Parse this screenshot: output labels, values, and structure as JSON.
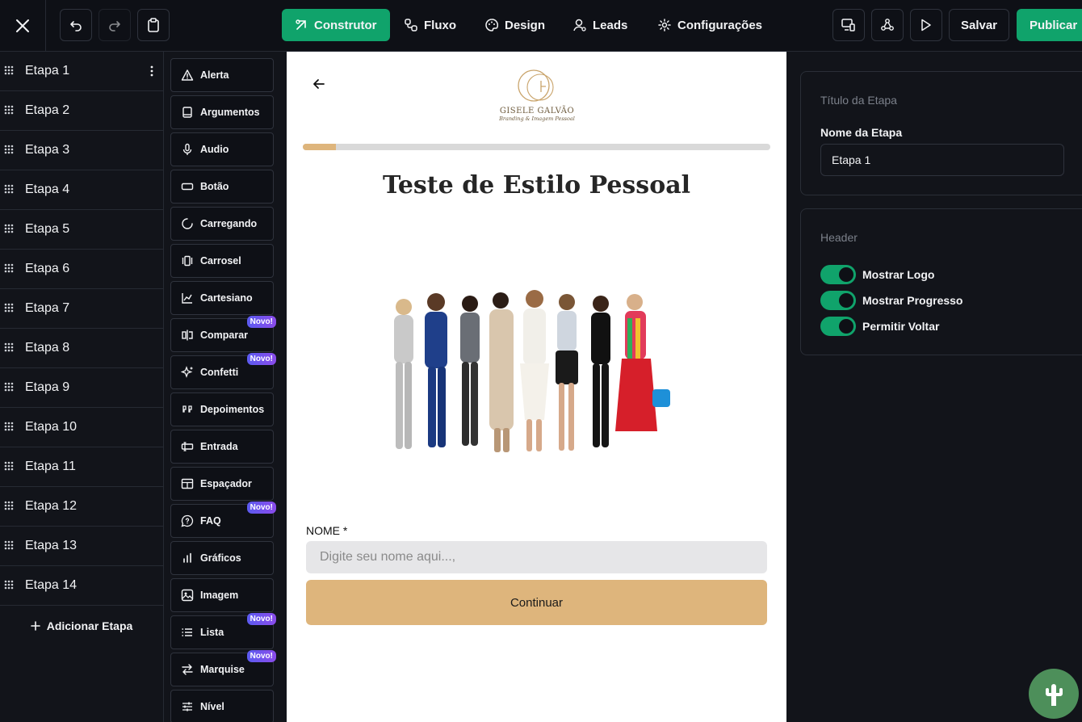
{
  "topbar": {
    "nav": [
      {
        "label": "Construtor",
        "icon": "construtor-icon",
        "active": true
      },
      {
        "label": "Fluxo",
        "icon": "flow-icon",
        "active": false
      },
      {
        "label": "Design",
        "icon": "palette-icon",
        "active": false
      },
      {
        "label": "Leads",
        "icon": "user-icon",
        "active": false
      },
      {
        "label": "Configurações",
        "icon": "gear-icon",
        "active": false
      }
    ],
    "save_label": "Salvar",
    "publish_label": "Publicar"
  },
  "steps": {
    "items": [
      "Etapa 1",
      "Etapa 2",
      "Etapa 3",
      "Etapa 4",
      "Etapa 5",
      "Etapa 6",
      "Etapa 7",
      "Etapa 8",
      "Etapa 9",
      "Etapa 10",
      "Etapa 11",
      "Etapa 12",
      "Etapa 13",
      "Etapa 14"
    ],
    "add_label": "Adicionar Etapa"
  },
  "components": {
    "badge_label": "Novo!",
    "items": [
      {
        "label": "Alerta",
        "icon": "alert-icon",
        "badge": false
      },
      {
        "label": "Argumentos",
        "icon": "book-icon",
        "badge": false
      },
      {
        "label": "Audio",
        "icon": "mic-icon",
        "badge": false
      },
      {
        "label": "Botão",
        "icon": "button-icon",
        "badge": false
      },
      {
        "label": "Carregando",
        "icon": "loading-icon",
        "badge": false
      },
      {
        "label": "Carrosel",
        "icon": "carousel-icon",
        "badge": false
      },
      {
        "label": "Cartesiano",
        "icon": "chart-area-icon",
        "badge": false
      },
      {
        "label": "Comparar",
        "icon": "compare-icon",
        "badge": true
      },
      {
        "label": "Confetti",
        "icon": "sparkles-icon",
        "badge": true
      },
      {
        "label": "Depoimentos",
        "icon": "quote-icon",
        "badge": false
      },
      {
        "label": "Entrada",
        "icon": "input-icon",
        "badge": false
      },
      {
        "label": "Espaçador",
        "icon": "spacer-icon",
        "badge": false
      },
      {
        "label": "FAQ",
        "icon": "faq-icon",
        "badge": true
      },
      {
        "label": "Gráficos",
        "icon": "bar-chart-icon",
        "badge": false
      },
      {
        "label": "Imagem",
        "icon": "image-icon",
        "badge": false
      },
      {
        "label": "Lista",
        "icon": "list-icon",
        "badge": true
      },
      {
        "label": "Marquise",
        "icon": "arrows-icon",
        "badge": true
      },
      {
        "label": "Nível",
        "icon": "sliders-icon",
        "badge": false
      }
    ]
  },
  "canvas": {
    "logo_brand": "GISELE GALVÃO",
    "logo_tagline": "Branding & Imagem Pessoal",
    "progress_fraction": 0.07,
    "title": "Teste de Estilo Pessoal",
    "field_label": "NOME *",
    "field_placeholder": "Digite seu nome aqui...,",
    "cta_label": "Continuar",
    "colors": {
      "accent": "#deb57c",
      "primary": "#10a36b"
    }
  },
  "panel": {
    "step_section_title": "Título da Etapa",
    "step_name_label": "Nome da Etapa",
    "step_name_value": "Etapa 1",
    "header_section_title": "Header",
    "toggles": [
      {
        "label": "Mostrar Logo",
        "on": true
      },
      {
        "label": "Mostrar Progresso",
        "on": true
      },
      {
        "label": "Permitir Voltar",
        "on": true
      }
    ]
  }
}
